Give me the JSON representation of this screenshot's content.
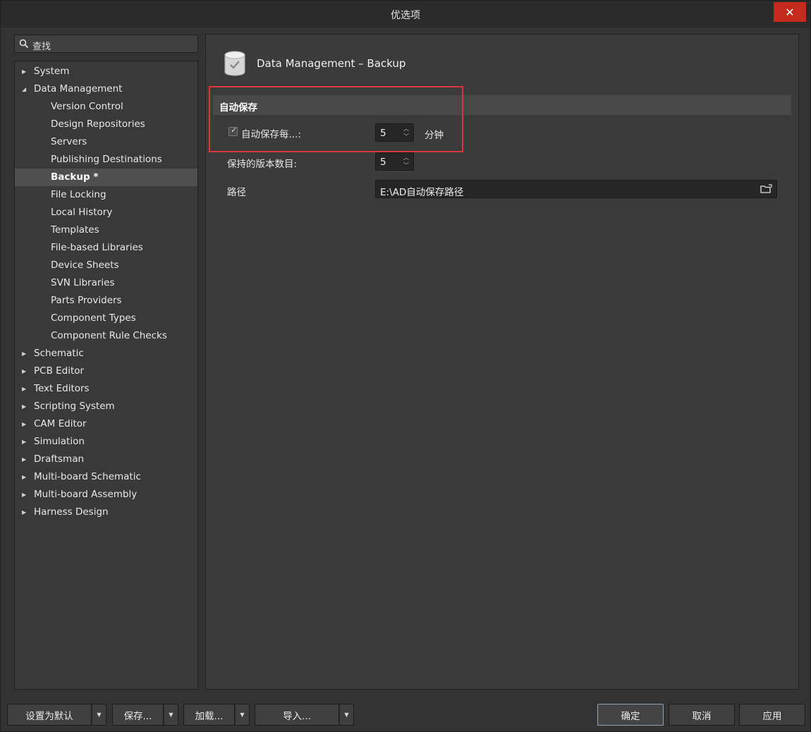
{
  "window": {
    "title": "优选项"
  },
  "search": {
    "placeholder": "查找"
  },
  "tree": {
    "items": [
      {
        "label": "System",
        "level": 0,
        "expanded": false
      },
      {
        "label": "Data Management",
        "level": 0,
        "expanded": true
      },
      {
        "label": "Version Control",
        "level": 1
      },
      {
        "label": "Design Repositories",
        "level": 1
      },
      {
        "label": "Servers",
        "level": 1
      },
      {
        "label": "Publishing Destinations",
        "level": 1
      },
      {
        "label": "Backup *",
        "level": 1,
        "selected": true
      },
      {
        "label": "File Locking",
        "level": 1
      },
      {
        "label": "Local History",
        "level": 1
      },
      {
        "label": "Templates",
        "level": 1
      },
      {
        "label": "File-based Libraries",
        "level": 1
      },
      {
        "label": "Device Sheets",
        "level": 1
      },
      {
        "label": "SVN Libraries",
        "level": 1
      },
      {
        "label": "Parts Providers",
        "level": 1
      },
      {
        "label": "Component Types",
        "level": 1
      },
      {
        "label": "Component Rule Checks",
        "level": 1
      },
      {
        "label": "Schematic",
        "level": 0,
        "expanded": false
      },
      {
        "label": "PCB Editor",
        "level": 0,
        "expanded": false
      },
      {
        "label": "Text Editors",
        "level": 0,
        "expanded": false
      },
      {
        "label": "Scripting System",
        "level": 0,
        "expanded": false
      },
      {
        "label": "CAM Editor",
        "level": 0,
        "expanded": false
      },
      {
        "label": "Simulation",
        "level": 0,
        "expanded": false
      },
      {
        "label": "Draftsman",
        "level": 0,
        "expanded": false
      },
      {
        "label": "Multi-board Schematic",
        "level": 0,
        "expanded": false
      },
      {
        "label": "Multi-board Assembly",
        "level": 0,
        "expanded": false
      },
      {
        "label": "Harness Design",
        "level": 0,
        "expanded": false
      }
    ]
  },
  "content": {
    "page_title": "Data Management – Backup",
    "section_title": "自动保存",
    "autosave": {
      "label": "自动保存每...:",
      "checked": true,
      "value": "5",
      "unit": "分钟"
    },
    "versions": {
      "label": "保持的版本数目:",
      "value": "5"
    },
    "path": {
      "label": "路径",
      "value": "E:\\AD自动保存路径"
    }
  },
  "footer": {
    "set_default": "设置为默认",
    "save": "保存...",
    "load": "加载...",
    "import": "导入...",
    "ok": "确定",
    "cancel": "取消",
    "apply": "应用"
  },
  "colors": {
    "highlight_border": "#d9363e",
    "close_button": "#c42b1c",
    "selected_row": "#4f4f4f"
  }
}
